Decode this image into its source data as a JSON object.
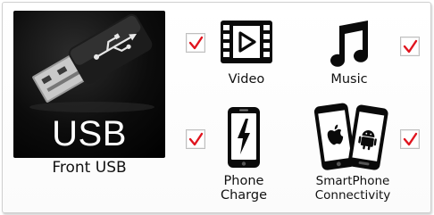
{
  "usb": {
    "tile_label": "USB",
    "caption": "Front USB"
  },
  "features": {
    "video": {
      "label": "Video",
      "checked": true,
      "icon": "film-play-icon"
    },
    "music": {
      "label": "Music",
      "checked": true,
      "icon": "music-note-icon"
    },
    "phone_charge": {
      "label_line1": "Phone",
      "label_line2": "Charge",
      "checked": true,
      "icon": "phone-charge-icon"
    },
    "smartphone": {
      "label_line1": "SmartPhone",
      "label_line2": "Connectivity",
      "checked": true,
      "icon": "smartphones-icon"
    }
  },
  "colors": {
    "check_mark": "#e0141e",
    "icon": "#0a0a0a",
    "tile_bg": "#0c0c0c"
  }
}
